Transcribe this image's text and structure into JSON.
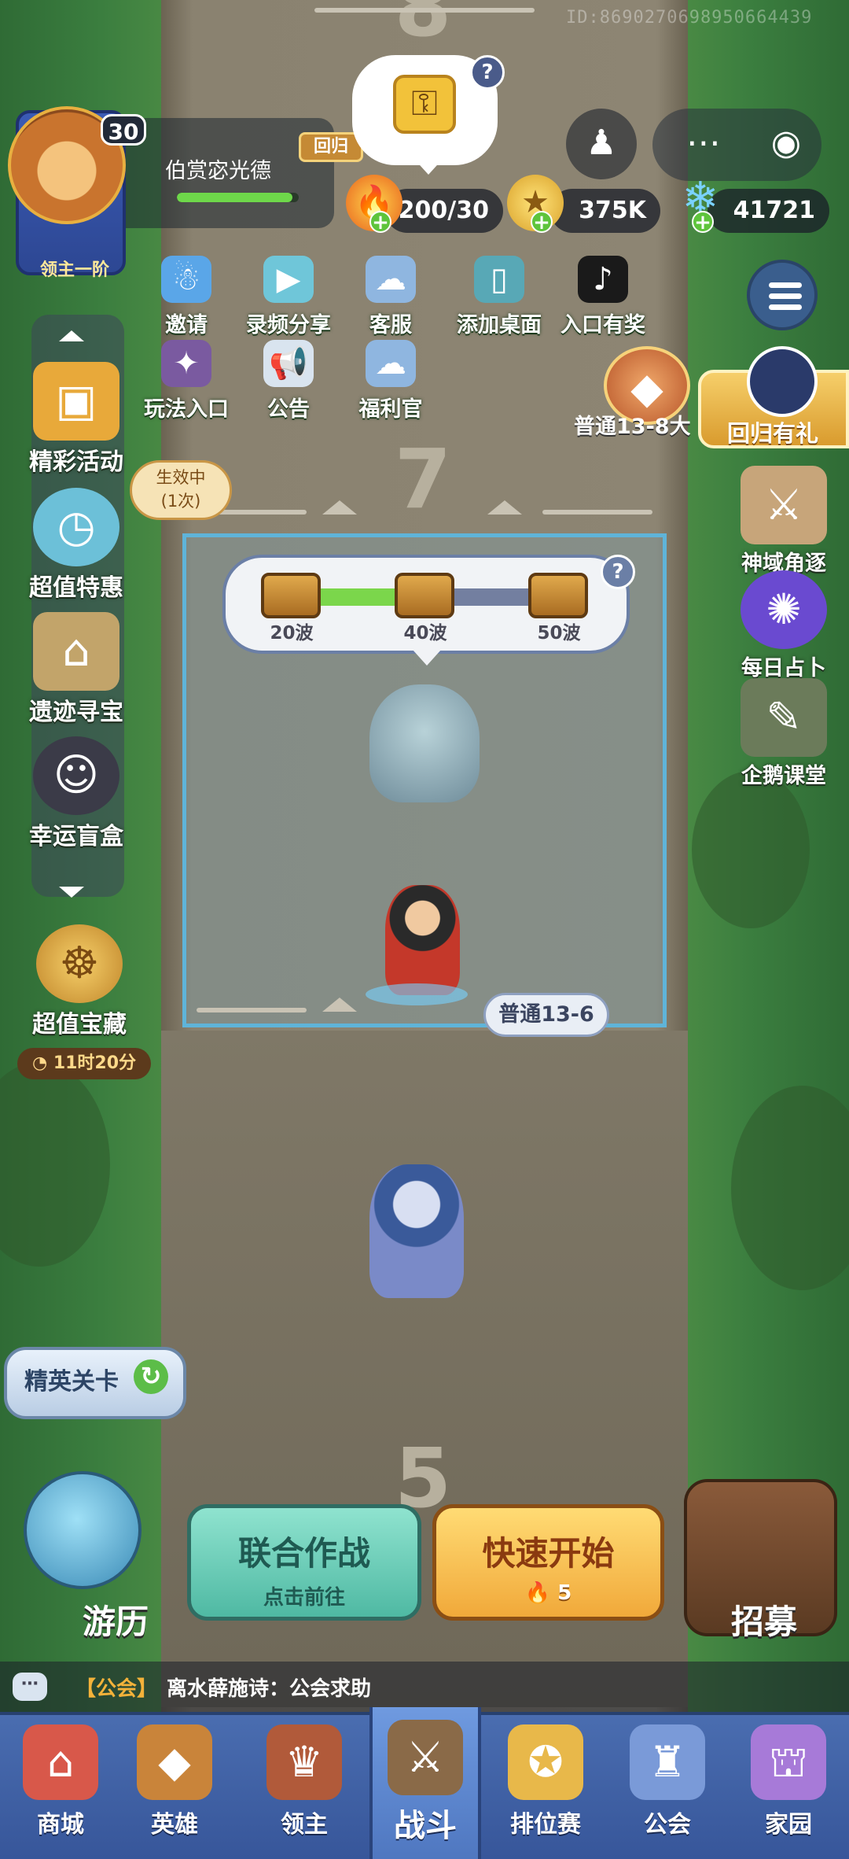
{
  "watermark": "ID:8690270698950664439",
  "player": {
    "level": "30",
    "name": "伯赏宓光德",
    "rank": "领主一阶",
    "return_tag": "回归",
    "hp_ratio": 0.95
  },
  "currencies": {
    "stamina": "200/30",
    "gold": "375K",
    "gems": "41721"
  },
  "system": {
    "profile_icon": "bust-icon",
    "more_icon": "ellipsis-icon",
    "record_icon": "target-icon"
  },
  "shortcuts": [
    {
      "label": "邀请",
      "icon": "snowman-invite-icon",
      "color": "#5aa6e8"
    },
    {
      "label": "录频分享",
      "icon": "video-camera-icon",
      "color": "#6fc6d9"
    },
    {
      "label": "客服",
      "icon": "ghost-support-icon",
      "color": "#8fb6e0"
    },
    {
      "label": "添加桌面",
      "icon": "phone-add-icon",
      "color": "#58a8b6"
    },
    {
      "label": "入口有奖",
      "icon": "tiktok-icon",
      "color": "#1a1a1a"
    },
    {
      "label": "玩法入口",
      "icon": "gamepad-icon",
      "color": "#7a5aa0"
    },
    {
      "label": "公告",
      "icon": "megaphone-icon",
      "color": "#d9e4ef"
    },
    {
      "label": "福利官",
      "icon": "ghost-gift-icon",
      "color": "#8fb6e0"
    }
  ],
  "left_menu": [
    {
      "label": "精彩活动",
      "icon": "treasure-chest-icon",
      "color": "#e8a93a"
    },
    {
      "label": "超值特惠",
      "icon": "stopwatch-icon",
      "color": "#6cc0d8"
    },
    {
      "label": "遗迹寻宝",
      "icon": "ruins-icon",
      "color": "#c2a46a"
    },
    {
      "label": "幸运盲盒",
      "icon": "tophat-character-icon",
      "color": "#3b3b48"
    }
  ],
  "effect_badge": {
    "line1": "生效中",
    "line2": "(1次)"
  },
  "value_treasure": {
    "label": "超值宝藏",
    "timer": "11时20分"
  },
  "right_menu": [
    {
      "label": "神域角逐",
      "icon": "crossed-swords-icon",
      "color": "#c7a57a"
    },
    {
      "label": "每日占卜",
      "icon": "crystal-ball-icon",
      "color": "#6a4ad0"
    },
    {
      "label": "企鹅课堂",
      "icon": "penguin-teacher-icon",
      "color": "#6b7b5a"
    }
  ],
  "normal_chip": "普通13-8大",
  "return_gift": "回归有礼",
  "road_numbers": {
    "top": "8",
    "middle": "7",
    "bottom": "5"
  },
  "waves": {
    "progress": 0.55,
    "milestones": [
      "20波",
      "40波",
      "50波"
    ]
  },
  "stage_label": "普通13-6",
  "elite": "精英关卡",
  "coop": {
    "title": "联合作战",
    "sub": "点击前往"
  },
  "quick_start": {
    "title": "快速开始",
    "cost": "5"
  },
  "travel": "游历",
  "recruit": "招募",
  "chat": {
    "channel": "【公会】",
    "message": "离水薛施诗：公会求助"
  },
  "nav": [
    {
      "label": "商城",
      "icon": "shop-icon",
      "color": "#d8584a",
      "active": false
    },
    {
      "label": "英雄",
      "icon": "hero-card-icon",
      "color": "#c9843a",
      "active": false
    },
    {
      "label": "领主",
      "icon": "banner-crown-icon",
      "color": "#b15a3a",
      "active": false
    },
    {
      "label": "战斗",
      "icon": "battle-weapons-icon",
      "color": "#8a6a48",
      "active": true
    },
    {
      "label": "排位赛",
      "icon": "shield-star-icon",
      "color": "#e8b84a",
      "active": false
    },
    {
      "label": "公会",
      "icon": "castle-icon",
      "color": "#7a9ad8",
      "active": false
    },
    {
      "label": "家园",
      "icon": "palace-icon",
      "color": "#a77ad8",
      "active": false
    }
  ]
}
